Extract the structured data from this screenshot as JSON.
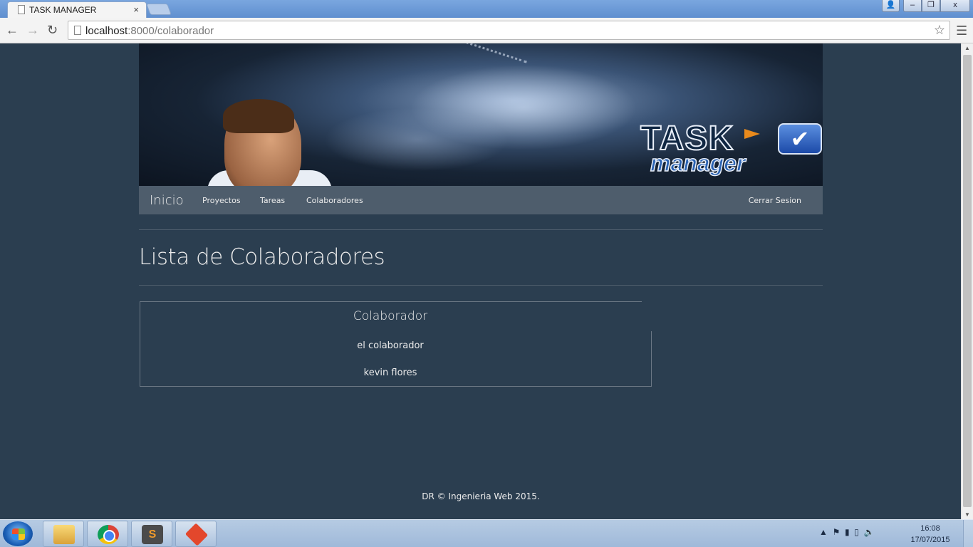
{
  "browser": {
    "tab_title": "TASK MANAGER",
    "tab_close": "×",
    "url_host": "localhost",
    "url_path": ":8000/colaborador",
    "win_user": "👤",
    "win_min": "–",
    "win_max": "❐",
    "win_close": "x"
  },
  "banner": {
    "logo_word": "TASK",
    "logo_sub": "manager",
    "logo_check": "✔"
  },
  "navbar": {
    "brand": "Inicio",
    "links": [
      "Proyectos",
      "Tareas",
      "Colaboradores"
    ],
    "logout": "Cerrar Sesion"
  },
  "page": {
    "title": "Lista de Colaboradores"
  },
  "table": {
    "header": "Colaborador",
    "rows": [
      "el colaborador",
      "kevin flores"
    ]
  },
  "footer": {
    "text": "DR © Ingenieria Web 2015."
  },
  "taskbar": {
    "apps": [
      "explorer-icon",
      "chrome-icon",
      "sublime-text-icon",
      "git-icon"
    ],
    "sublime_glyph": "S",
    "time": "16:08",
    "date": "17/07/2015"
  }
}
